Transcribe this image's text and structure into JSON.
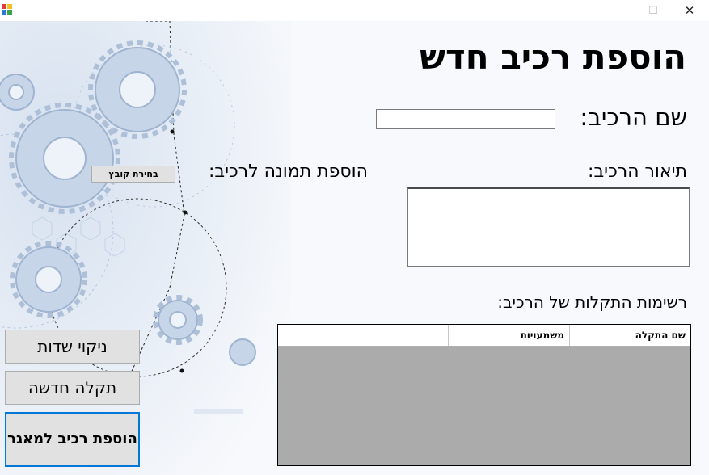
{
  "window": {
    "controls": {
      "minimize": "—",
      "maximize": "☐",
      "close": "✕"
    }
  },
  "form": {
    "title": "הוספת רכיב חדש",
    "name_label": "שם הרכיב:",
    "name_value": "",
    "description_label": "תיאור הרכיב:",
    "description_value": "",
    "image_label": "הוספת תמונה לרכיב:",
    "choose_file_button": "בחירת קובץ",
    "faults_label": "רשימות התקלות של הרכיב:",
    "faults_table": {
      "columns": [
        "שם התקלה",
        "משמעויות"
      ],
      "rows": []
    }
  },
  "actions": {
    "clear_fields": "ניקוי שדות",
    "new_fault": "תקלה חדשה",
    "add_component": "הוספת רכיב למאגר"
  },
  "colors": {
    "accent_focus": "#0078d7",
    "grid_background": "#ababab",
    "button_face": "#e1e1e1"
  }
}
